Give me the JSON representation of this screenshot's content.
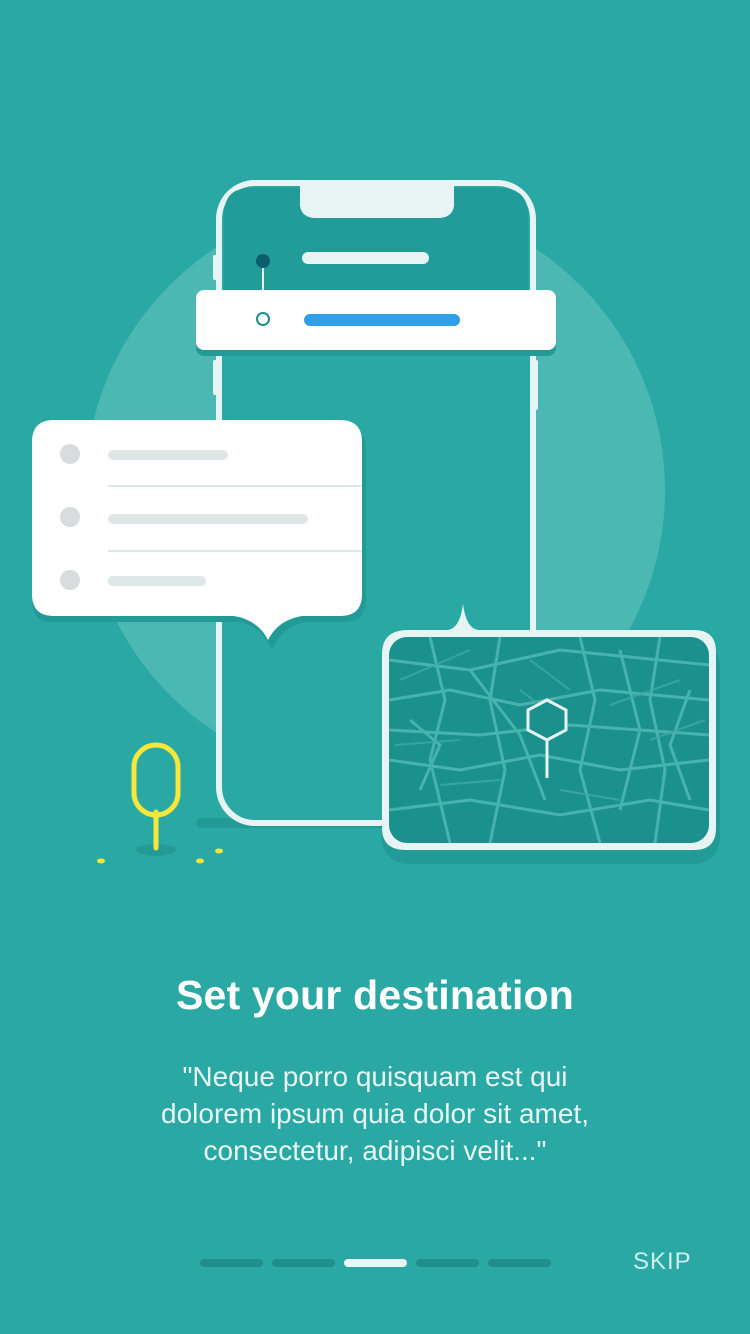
{
  "onboarding": {
    "title": "Set your destination",
    "subtitle_lines": [
      "\"Neque porro quisquam est qui",
      "dolorem ipsum quia dolor sit amet,",
      "consectetur, adipisci velit...\""
    ],
    "skip_label": "SKIP",
    "pager": {
      "total": 5,
      "current": 3
    }
  },
  "colors": {
    "background": "#2aa8a4",
    "accent_blue": "#2f9fe8",
    "accent_yellow": "#f5e83a",
    "card": "#ffffff"
  },
  "icons": [
    "phone-illustration",
    "route-card-illustration",
    "list-bubble-illustration",
    "map-pin-icon",
    "location-pin-icon"
  ]
}
